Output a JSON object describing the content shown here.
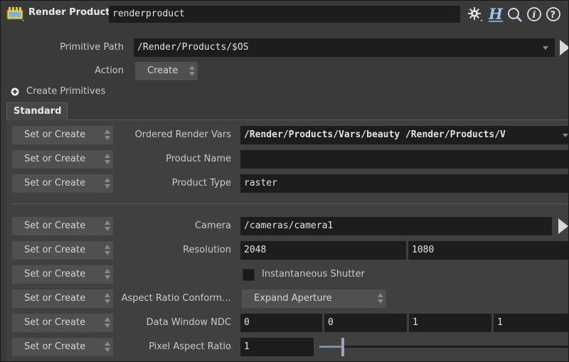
{
  "header": {
    "node_type": "Render Product",
    "node_name": "renderproduct"
  },
  "top": {
    "primitive_path_label": "Primitive Path",
    "primitive_path_value": "/Render/Products/$OS",
    "action_label": "Action",
    "action_value": "Create",
    "create_primitives_label": "Create Primitives"
  },
  "tabs": [
    {
      "label": "Standard"
    }
  ],
  "rows": {
    "set_or_create": "Set or Create",
    "ordered_render_vars": {
      "label": "Ordered Render Vars",
      "value": "/Render/Products/Vars/beauty /Render/Products/V"
    },
    "product_name": {
      "label": "Product Name",
      "value": ""
    },
    "product_type": {
      "label": "Product Type",
      "value": "raster"
    },
    "camera": {
      "label": "Camera",
      "value": "/cameras/camera1"
    },
    "resolution": {
      "label": "Resolution",
      "values": [
        "2048",
        "1080"
      ]
    },
    "instantaneous_shutter": {
      "label": "Instantaneous Shutter",
      "checked": false
    },
    "aspect_ratio_conform": {
      "label": "Aspect Ratio Conform…",
      "value": "Expand Aperture"
    },
    "data_window_ndc": {
      "label": "Data Window NDC",
      "values": [
        "0",
        "0",
        "1",
        "1"
      ]
    },
    "pixel_aspect_ratio": {
      "label": "Pixel Aspect Ratio",
      "value": "1"
    }
  },
  "colors": {
    "background": "#3a3a3a",
    "field": "#1d1d1d",
    "button": "#505050",
    "slider_handle": "#9aa6b8"
  }
}
